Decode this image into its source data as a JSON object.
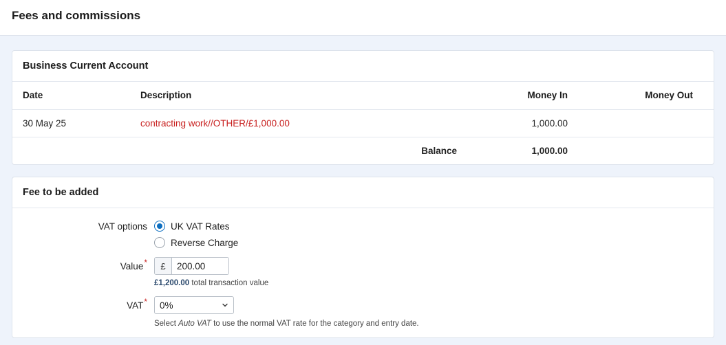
{
  "page": {
    "title": "Fees and commissions"
  },
  "account_card": {
    "title": "Business Current Account",
    "columns": {
      "date": "Date",
      "description": "Description",
      "money_in": "Money In",
      "money_out": "Money Out"
    },
    "rows": [
      {
        "date": "30 May 25",
        "description": "contracting work//OTHER/£1,000.00",
        "money_in": "1,000.00",
        "money_out": ""
      }
    ],
    "balance": {
      "label": "Balance",
      "value": "1,000.00"
    }
  },
  "fee_card": {
    "title": "Fee to be added",
    "vat_options": {
      "label": "VAT options",
      "options": [
        {
          "label": "UK VAT Rates",
          "checked": true
        },
        {
          "label": "Reverse Charge",
          "checked": false
        }
      ]
    },
    "value": {
      "label": "Value",
      "required_mark": "*",
      "currency": "£",
      "amount": "200.00",
      "total_amount": "£1,200.00",
      "total_text": " total transaction value"
    },
    "vat": {
      "label": "VAT",
      "required_mark": "*",
      "selected": "0%",
      "help_pre": "Select ",
      "help_em": "Auto VAT",
      "help_post": " to use the normal VAT rate for the category and entry date."
    }
  },
  "colors": {
    "accent": "#0c6ec0",
    "link_red": "#c8201f",
    "background": "#eef3fb"
  }
}
